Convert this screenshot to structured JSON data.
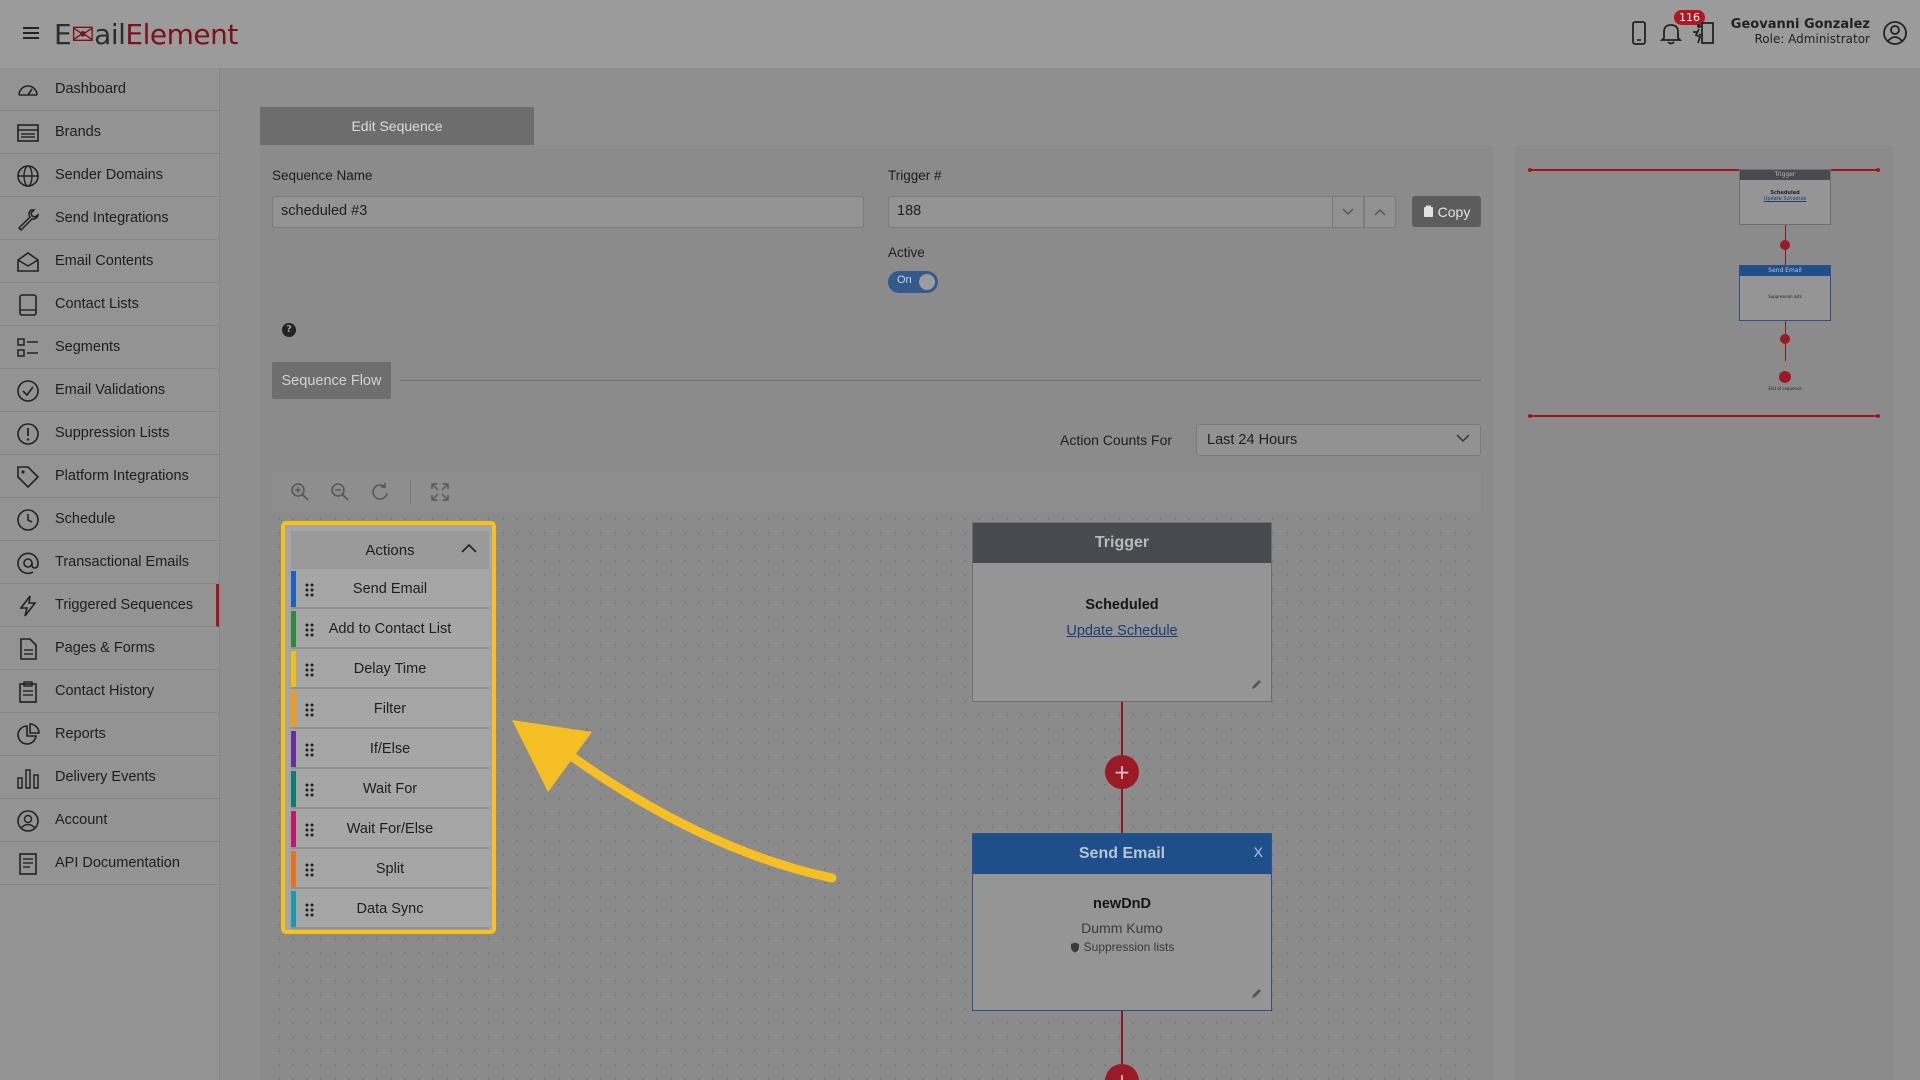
{
  "app": {
    "logo_prefix": "E",
    "logo_mid": "ail",
    "logo_suffix": "Element",
    "notification_count": "116"
  },
  "user": {
    "name": "Geovanni Gonzalez",
    "role": "Role: Administrator"
  },
  "sidebar": {
    "items": [
      {
        "label": "Dashboard",
        "icon": "gauge-icon"
      },
      {
        "label": "Brands",
        "icon": "list-box-icon"
      },
      {
        "label": "Sender Domains",
        "icon": "globe-icon"
      },
      {
        "label": "Send Integrations",
        "icon": "wrench-icon"
      },
      {
        "label": "Email Contents",
        "icon": "envelope-open-icon"
      },
      {
        "label": "Contact Lists",
        "icon": "book-icon"
      },
      {
        "label": "Segments",
        "icon": "segments-icon"
      },
      {
        "label": "Email Validations",
        "icon": "check-circle-icon"
      },
      {
        "label": "Suppression Lists",
        "icon": "alert-circle-icon"
      },
      {
        "label": "Platform Integrations",
        "icon": "tag-icon"
      },
      {
        "label": "Schedule",
        "icon": "clock-icon"
      },
      {
        "label": "Transactional Emails",
        "icon": "at-icon"
      },
      {
        "label": "Triggered Sequences",
        "icon": "lightning-icon"
      },
      {
        "label": "Pages & Forms",
        "icon": "file-icon"
      },
      {
        "label": "Contact History",
        "icon": "clipboard-icon"
      },
      {
        "label": "Reports",
        "icon": "pie-chart-icon"
      },
      {
        "label": "Delivery Events",
        "icon": "bar-chart-icon"
      },
      {
        "label": "Account",
        "icon": "user-circle-icon"
      },
      {
        "label": "API Documentation",
        "icon": "document-icon"
      }
    ],
    "active": "Triggered Sequences"
  },
  "page": {
    "tab_label": "Edit Sequence",
    "sequence_name_label": "Sequence Name",
    "sequence_name_value": "scheduled #3",
    "trigger_label": "Trigger #",
    "trigger_value": "188",
    "copy_label": "Copy",
    "active_label": "Active",
    "active_toggle": "On",
    "help_glyph": "?",
    "sequence_flow_label": "Sequence Flow",
    "action_counts_label": "Action Counts For",
    "action_counts_value": "Last 24 Hours"
  },
  "actions_panel": {
    "title": "Actions",
    "items": [
      {
        "label": "Send Email",
        "color": "#1f5fbf"
      },
      {
        "label": "Add to Contact List",
        "color": "#2e8b3e"
      },
      {
        "label": "Delay Time",
        "color": "#f2c011"
      },
      {
        "label": "Filter",
        "color": "#f29a11"
      },
      {
        "label": "If/Else",
        "color": "#6a2aa0"
      },
      {
        "label": "Wait For",
        "color": "#0e7f6f"
      },
      {
        "label": "Wait For/Else",
        "color": "#c0186a"
      },
      {
        "label": "Split",
        "color": "#e8731a"
      },
      {
        "label": "Data Sync",
        "color": "#1a9ab0"
      }
    ]
  },
  "flow": {
    "trigger": {
      "title": "Trigger",
      "type": "Scheduled",
      "link": "Update Schedule"
    },
    "send_email": {
      "title": "Send Email",
      "close": "X",
      "name": "newDnD",
      "sub": "Dumm Kumo",
      "note": "Suppression lists"
    },
    "plus_glyph": "+"
  },
  "preview": {
    "trigger_title": "Trigger",
    "trigger_type": "Scheduled",
    "trigger_link": "Update Schedule",
    "email_title": "Send Email",
    "email_note": "Suppression lists",
    "end_label": "End of sequence"
  },
  "colors": {
    "accent": "#a3121d",
    "highlight": "#f7c21b",
    "arrow": "#f5bf25"
  }
}
